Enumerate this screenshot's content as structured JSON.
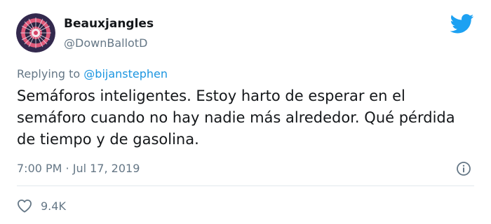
{
  "user": {
    "display_name": "Beauxjangles",
    "handle": "@DownBallotD"
  },
  "reply": {
    "prefix": "Replying to",
    "mention": "@bijanstephen"
  },
  "tweet": {
    "text": "Semáforos inteligentes. Estoy harto de esperar en el semáforo cuando no hay nadie más alrededor. Qué pérdida de tiempo y de gasolina.",
    "timestamp": "7:00 PM · Jul 17, 2019"
  },
  "stats": {
    "likes": "9.4K"
  },
  "icons": {
    "brand": "twitter-bird-icon",
    "info": "info-icon",
    "like": "heart-icon"
  },
  "colors": {
    "accent": "#1da1f2",
    "mention": "#1b95e0",
    "secondary_text": "#657786"
  }
}
